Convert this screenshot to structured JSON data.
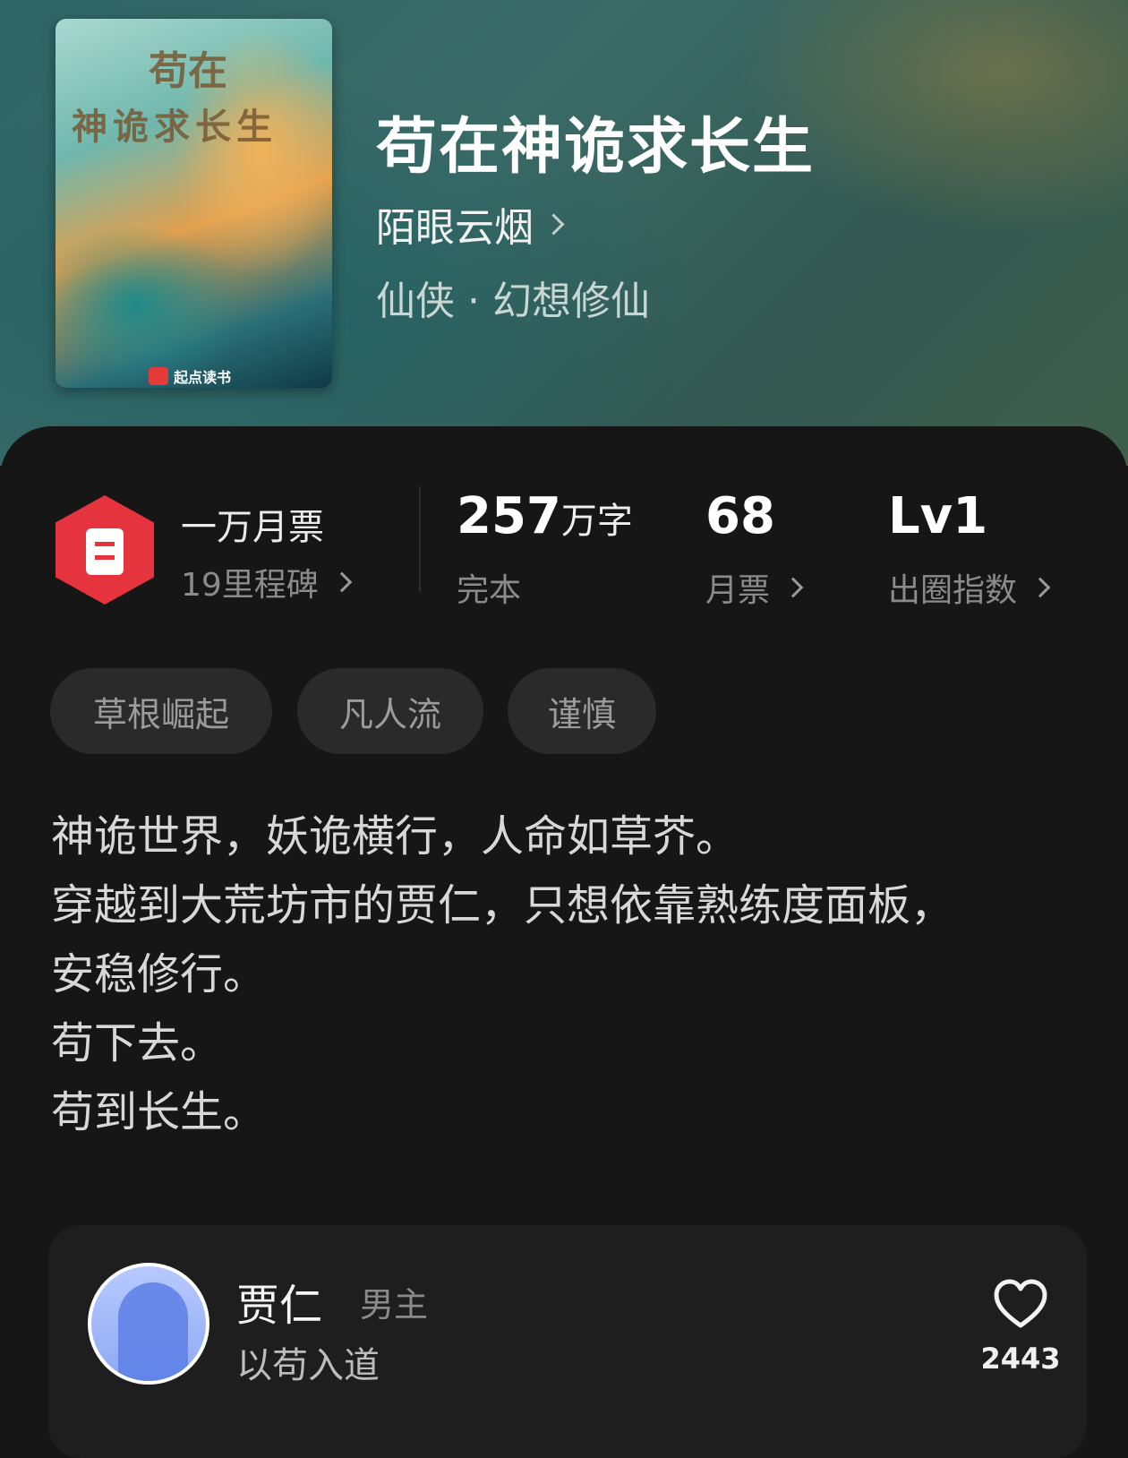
{
  "book": {
    "title": "苟在神诡求长生",
    "author": "陌眼云烟",
    "genre": "仙侠 · 幻想修仙",
    "cover_title_line1": "苟在",
    "cover_title_line2": "神诡求长生",
    "cover_brand": "起点读书"
  },
  "stats": {
    "milestone_label": "一万月票",
    "milestone_sub": "19里程碑",
    "words_value": "257",
    "words_unit": "万字",
    "status": "完本",
    "monthly_votes_value": "68",
    "monthly_votes_label": "月票",
    "level_value": "Lv1",
    "level_label": "出圈指数"
  },
  "tags": [
    "草根崛起",
    "凡人流",
    "谨慎"
  ],
  "intro": [
    "神诡世界，妖诡横行，人命如草芥。",
    "穿越到大荒坊市的贾仁，只想依靠熟练度面板，",
    "安稳修行。",
    "苟下去。",
    "苟到长生。"
  ],
  "character": {
    "name": "贾仁",
    "role": "男主",
    "description": "以苟入道",
    "likes": "2443"
  },
  "colors": {
    "accent_red": "#e5343d",
    "panel_bg": "#161616",
    "tag_bg": "#2a2a2a"
  }
}
